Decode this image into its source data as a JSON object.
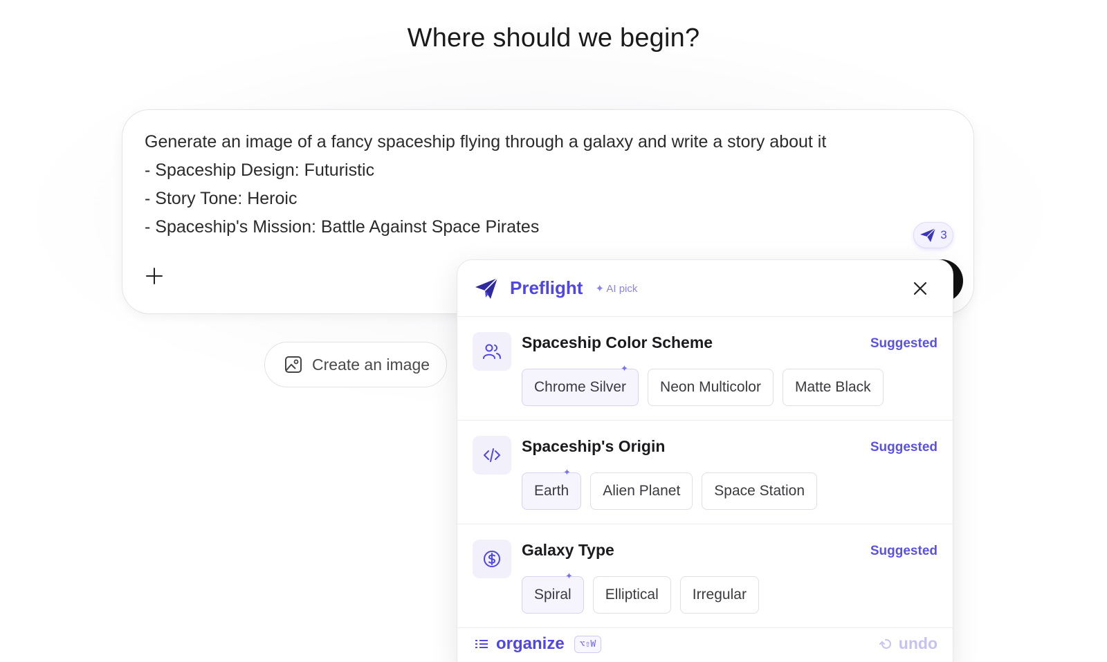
{
  "headline": "Where should we begin?",
  "composer": {
    "lines": [
      "Generate an image of a fancy spaceship flying through a galaxy and write a story about it",
      "- Spaceship Design: Futuristic",
      "- Story Tone: Heroic",
      "- Spaceship's Mission: Battle Against Space Pirates"
    ],
    "badge_count": "3"
  },
  "chips": {
    "create_image": "Create an image"
  },
  "preflight": {
    "title": "Preflight",
    "ai_pick": "✦ AI pick",
    "sections": [
      {
        "icon": "users-icon",
        "title": "Spaceship Color Scheme",
        "suggested": "Suggested",
        "options": [
          "Chrome Silver",
          "Neon Multicolor",
          "Matte Black"
        ],
        "selected": 0
      },
      {
        "icon": "code-icon",
        "title": "Spaceship's Origin",
        "suggested": "Suggested",
        "options": [
          "Earth",
          "Alien Planet",
          "Space Station"
        ],
        "selected": 0
      },
      {
        "icon": "dollar-icon",
        "title": "Galaxy Type",
        "suggested": "Suggested",
        "options": [
          "Spiral",
          "Elliptical",
          "Irregular"
        ],
        "selected": 0
      }
    ],
    "footer": {
      "organize": "organize",
      "shortcut": "⌥⇧W",
      "undo": "undo"
    }
  },
  "colors": {
    "accent": "#4f46e5",
    "accent_light": "#f3f2fe"
  }
}
